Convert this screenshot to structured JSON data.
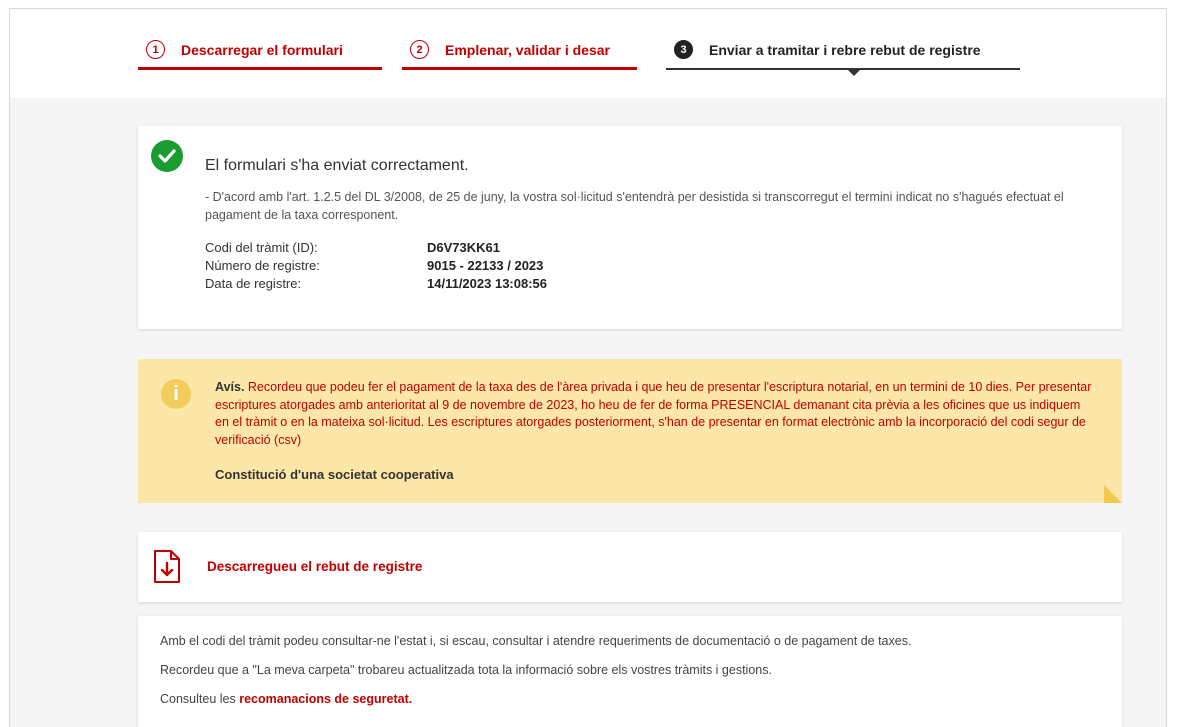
{
  "steps": [
    {
      "num": "1",
      "label": "Descarregar el formulari"
    },
    {
      "num": "2",
      "label": "Emplenar, validar i desar"
    },
    {
      "num": "3",
      "label": "Enviar a tramitar i rebre rebut de registre"
    }
  ],
  "success": {
    "title": "El formulari s'ha enviat correctament.",
    "note": "- D'acord amb l'art. 1.2.5 del DL 3/2008, de 25 de juny, la vostra sol·licitud s'entendrà per desistida si transcorregut el termini indicat no s'hagués efectuat el pagament de la taxa corresponent.",
    "fields": [
      {
        "label": "Codi del tràmit (ID):",
        "value": "D6V73KK61"
      },
      {
        "label": "Número de registre:",
        "value": "9015 - 22133 / 2023"
      },
      {
        "label": "Data de registre:",
        "value": "14/11/2023 13:08:56"
      }
    ]
  },
  "warning": {
    "lead": "Avís.",
    "text": "Recordeu que podeu fer el pagament de la taxa des de l'àrea privada i que heu de presentar l'escriptura notarial, en un termini de 10 dies. Per presentar escriptures atorgades amb anterioritat al 9 de novembre de 2023, ho heu de fer de forma PRESENCIAL demanant cita prèvia a les oficines que us indiquem en el tràmit o en la mateixa sol·licitud. Les escriptures atorgades posteriorment, s'han de presentar en format electrònic amb la incorporació del codi segur de verificació (csv)",
    "subject": "Constitució d'una societat cooperativa"
  },
  "download": {
    "label": "Descarregueu el rebut de registre"
  },
  "footer": {
    "line1": "Amb el codi del tràmit podeu consultar-ne l'estat i, si escau, consultar i atendre requeriments de documentació o de pagament de taxes.",
    "line2": "Recordeu que a \"La meva carpeta\" trobareu actualitzada tota la informació sobre els vostres tràmits i gestions.",
    "line3_prefix": "Consulteu les",
    "line3_link": "recomanacions de seguretat."
  },
  "colors": {
    "accent": "#c00000",
    "success": "#1a9c2e",
    "warning_bg": "#fce7a8"
  }
}
